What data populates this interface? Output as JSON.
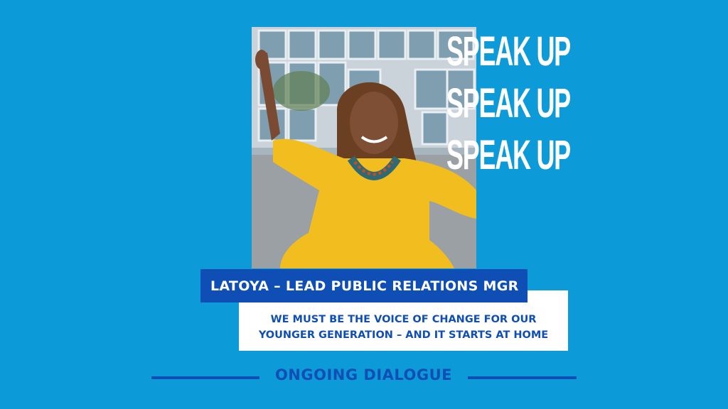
{
  "headline": {
    "lines": [
      "SPEAK UP",
      "SPEAK UP",
      "SPEAK UP"
    ]
  },
  "person": {
    "name_title": "LATOYA – LEAD PUBLIC RELATIONS MGR"
  },
  "quote": {
    "line1": "WE MUST BE THE VOICE OF CHANGE FOR OUR",
    "line2": "YOUNGER GENERATION – AND IT STARTS AT HOME"
  },
  "footer": {
    "label": "ONGOING DIALOGUE"
  },
  "colors": {
    "background": "#0d9ad8",
    "accent_dark_blue": "#0f4fb5",
    "white": "#ffffff",
    "dress_yellow": "#f2be1f"
  }
}
